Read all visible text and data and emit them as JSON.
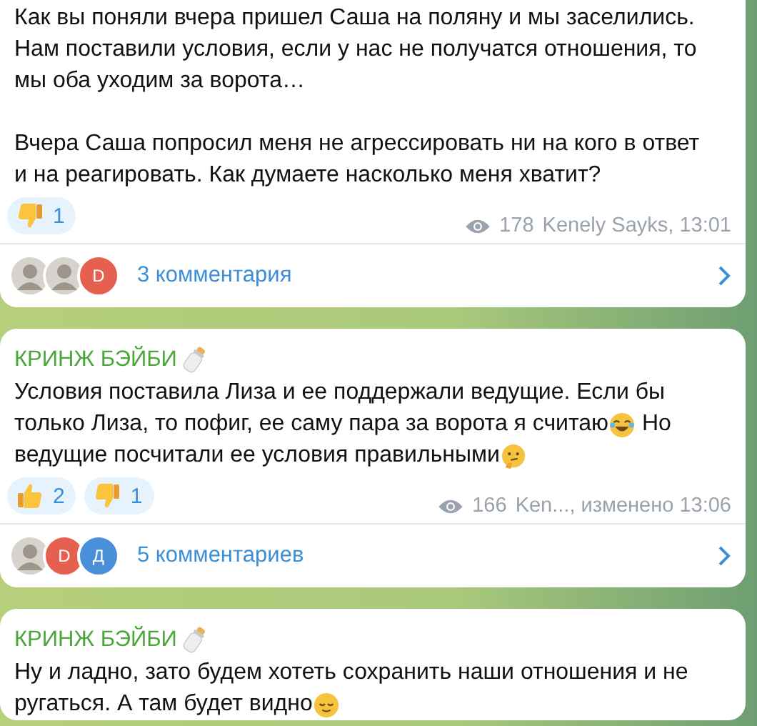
{
  "messages": [
    {
      "paragraphs": [
        {
          "lines": [
            {
              "parts": [
                {
                  "kind": "text",
                  "text": "Как вы поняли вчера пришел Саша на поляну и мы заселились."
                }
              ]
            },
            {
              "parts": [
                {
                  "kind": "text",
                  "text": "Нам поставили условия, если у нас не получатся отношения, то"
                }
              ]
            },
            {
              "parts": [
                {
                  "kind": "text",
                  "text": "мы оба уходим за ворота…"
                }
              ]
            }
          ]
        },
        {
          "lines": [
            {
              "parts": [
                {
                  "kind": "text",
                  "text": "Вчера Саша попросил меня не агрессировать ни на кого в ответ"
                }
              ]
            },
            {
              "parts": [
                {
                  "kind": "text",
                  "text": "и на реагировать. Как думаете насколько меня хватит?"
                }
              ]
            }
          ]
        }
      ],
      "reactions": [
        {
          "kind": "thumbs-down",
          "count": "1"
        }
      ],
      "views": "178",
      "signature": "Kenely Sayks, 13:01",
      "avatars": [
        {
          "kind": "photo"
        },
        {
          "kind": "photo"
        },
        {
          "kind": "letter",
          "letter": "D",
          "color": "#e5604f"
        }
      ],
      "comments": "3 комментария"
    },
    {
      "author": "КРИНЖ БЭЙБИ",
      "paragraphs": [
        {
          "lines": [
            {
              "parts": [
                {
                  "kind": "text",
                  "text": "Условия поставила Лиза и ее поддержали ведущие. Если бы"
                }
              ]
            },
            {
              "parts": [
                {
                  "kind": "text",
                  "text": "только Лиза, то пофиг, ее саму пара за ворота я считаю"
                },
                {
                  "kind": "laugh"
                },
                {
                  "kind": "text",
                  "text": " Но"
                }
              ]
            },
            {
              "parts": [
                {
                  "kind": "text",
                  "text": "ведущие посчитали ее условия правильными"
                },
                {
                  "kind": "think"
                }
              ]
            }
          ]
        }
      ],
      "reactions": [
        {
          "kind": "thumbs-up",
          "count": "2"
        },
        {
          "kind": "thumbs-down",
          "count": "1"
        }
      ],
      "views": "166",
      "signature": "Ken..., изменено 13:06",
      "avatars": [
        {
          "kind": "photo"
        },
        {
          "kind": "letter",
          "letter": "D",
          "color": "#e5604f"
        },
        {
          "kind": "letter",
          "letter": "Д",
          "color": "#4a90d9"
        }
      ],
      "comments": "5 комментариев"
    },
    {
      "author": "КРИНЖ БЭЙБИ",
      "paragraphs": [
        {
          "lines": [
            {
              "parts": [
                {
                  "kind": "text",
                  "text": "Ну и ладно, зато будем хотеть сохранить наши отношения и не"
                }
              ]
            },
            {
              "parts": [
                {
                  "kind": "text",
                  "text": "ругаться. А там будет видно"
                },
                {
                  "kind": "relieved"
                }
              ]
            }
          ]
        }
      ]
    }
  ]
}
